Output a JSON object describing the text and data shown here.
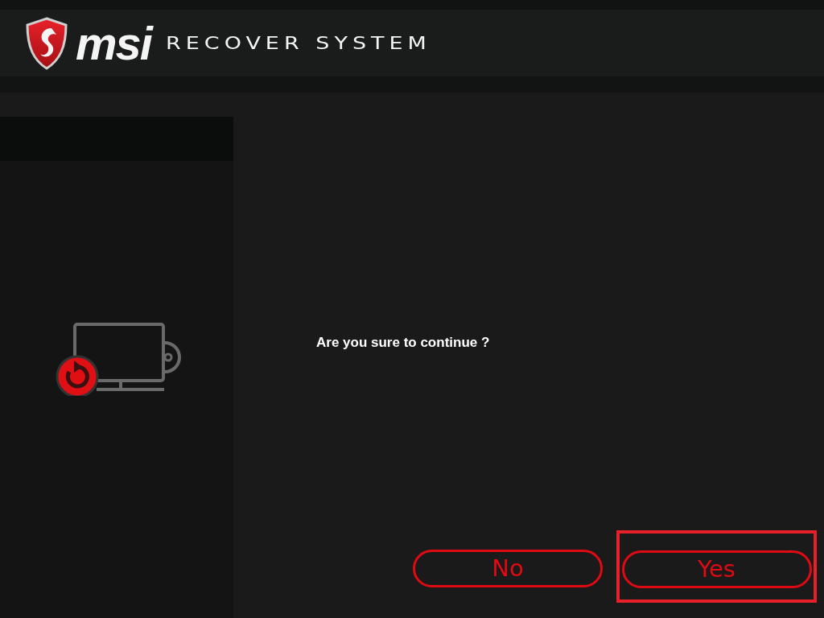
{
  "header": {
    "brand": "msi",
    "title": "RECOVER SYSTEM"
  },
  "dialog": {
    "message": "Are you sure to continue ?"
  },
  "buttons": [
    {
      "label": "No",
      "selected": false
    },
    {
      "label": "Yes",
      "selected": true
    }
  ]
}
